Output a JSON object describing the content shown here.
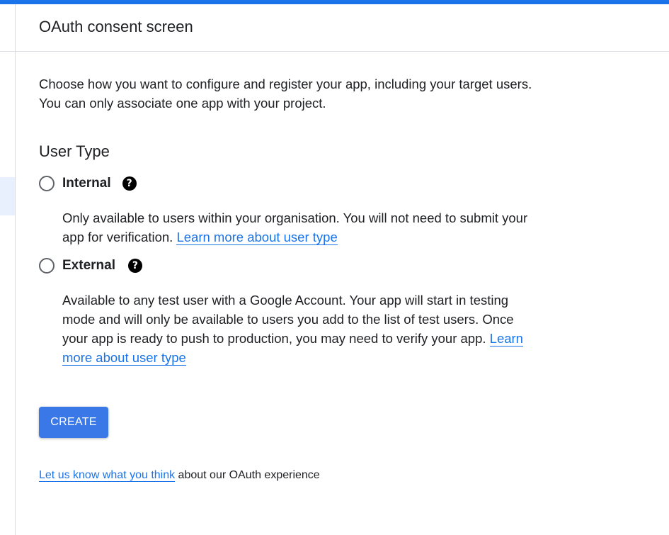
{
  "header": {
    "title": "OAuth consent screen"
  },
  "intro": {
    "text": "Choose how you want to configure and register your app, including your target users. You can only associate one app with your project."
  },
  "user_type": {
    "title": "User Type",
    "options": [
      {
        "label": "Internal",
        "selected": false,
        "help_icon": "help-circle-icon",
        "description": "Only available to users within your organisation. You will not need to submit your app for verification.",
        "link_text": "Learn more about user type"
      },
      {
        "label": "External",
        "selected": false,
        "help_icon": "help-circle-icon",
        "description": "Available to any test user with a Google Account. Your app will start in testing mode and will only be available to users you add to the list of test users. Once your app is ready to push to production, you may need to verify your app.",
        "link_text": "Learn more about user type"
      }
    ]
  },
  "actions": {
    "create_label": "CREATE"
  },
  "feedback": {
    "link_text": "Let us know what you think",
    "suffix": " about our OAuth experience"
  },
  "colors": {
    "accent": "#1a73e8",
    "button": "#3b78e7",
    "text": "#202124",
    "divider": "#dadce0"
  }
}
